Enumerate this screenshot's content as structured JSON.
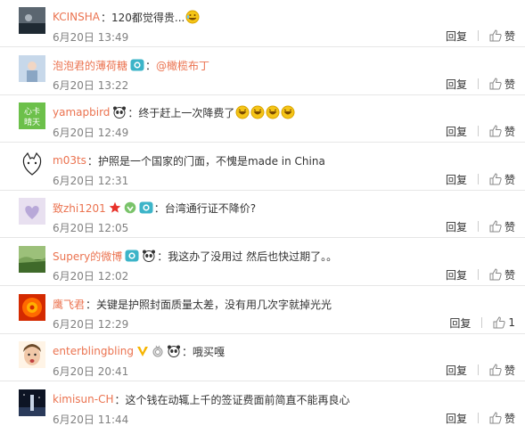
{
  "comments": [
    {
      "user": "KCINSHA",
      "colon": "：",
      "text": "120都觉得贵...",
      "time": "6月20日 13:49",
      "reply": "回复",
      "like": "赞",
      "emoji": "laughing-crying-emoji",
      "avatar_colors": [
        "#5b6670",
        "#1f2a33"
      ]
    },
    {
      "user": "泡泡君的薄荷糖",
      "colon": "：",
      "mention": "@橄榄布丁",
      "time": "6月20日 13:22",
      "reply": "回复",
      "like": "赞",
      "badge": "camera-badge",
      "avatar_colors": [
        "#c7d8ea",
        "#8aa6c4"
      ]
    },
    {
      "user": "yamapbird",
      "colon": "：",
      "text": "终于赶上一次降费了",
      "time": "6月20日 12:49",
      "reply": "回复",
      "like": "赞",
      "badge": "panda-badge",
      "emoji_count": 4,
      "avatar_text": "心卡 晴天",
      "avatar_colors": [
        "#6cc04a",
        "#ffffff"
      ]
    },
    {
      "user": "m03ts",
      "colon": "：",
      "text": "护照是一个国家的门面，不愧是made in China",
      "time": "6月20日 12:31",
      "reply": "回复",
      "like": "赞",
      "avatar_colors": [
        "#ffffff",
        "#222222"
      ]
    },
    {
      "user": "致zhi1201",
      "colon": "：",
      "text": "台湾通行证不降价?",
      "time": "6月20日 12:05",
      "reply": "回复",
      "like": "赞",
      "badges": [
        "red-star-badge",
        "green-badge",
        "camera-badge"
      ],
      "avatar_colors": [
        "#e8e0f0",
        "#b8a8d8"
      ]
    },
    {
      "user": "Supery的微博",
      "colon": "：",
      "text": "我这办了没用过 然后也快过期了。。",
      "time": "6月20日 12:02",
      "reply": "回复",
      "like": "赞",
      "badges": [
        "camera-badge",
        "panda-badge"
      ],
      "avatar_colors": [
        "#7aa35a",
        "#3f6a2a"
      ]
    },
    {
      "user": "鹰飞君",
      "colon": "：",
      "text": "关键是护照封面质量太差，没有用几次字就掉光光",
      "time": "6月20日 12:29",
      "reply": "回复",
      "like_count": "1",
      "avatar_colors": [
        "#ff6a00",
        "#d42a00"
      ]
    },
    {
      "user": "enterblingbling",
      "colon": "：",
      "text": "哦买嘎",
      "time": "6月20日 20:41",
      "reply": "回复",
      "like": "赞",
      "badges": [
        "v-badge",
        "medal-badge",
        "panda-badge"
      ],
      "avatar_colors": [
        "#f1c8a8",
        "#6b4a2a"
      ]
    },
    {
      "user": "kimisun-CH",
      "colon": "：",
      "text": "这个钱在动辄上千的签证费面前简直不能再良心",
      "time": "6月20日 11:44",
      "reply": "回复",
      "like": "赞",
      "avatar_colors": [
        "#2a3a5a",
        "#0d1424"
      ]
    }
  ]
}
